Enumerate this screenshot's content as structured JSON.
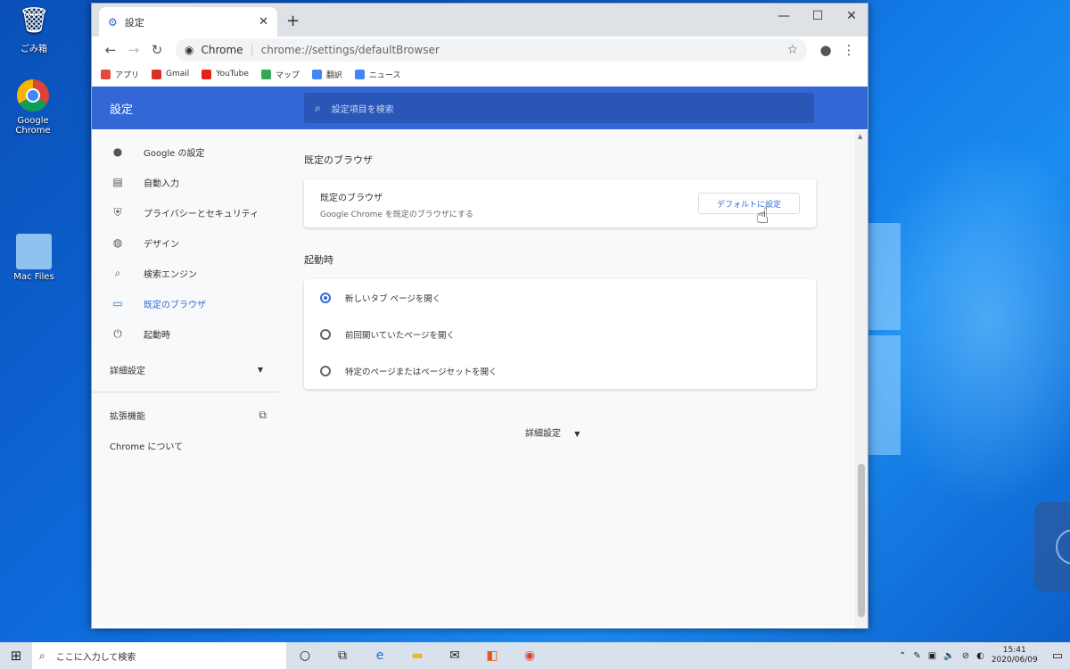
{
  "desktop": {
    "icons": [
      {
        "label": "ごみ箱",
        "glyph": "🗑"
      },
      {
        "label": "Google Chrome",
        "glyph": "◉"
      },
      {
        "label": "Mac Files",
        "glyph": "▇"
      }
    ]
  },
  "browser": {
    "tab_title": "設定",
    "tab_close": "✕",
    "new_tab": "+",
    "window_controls": {
      "minimize": "—",
      "maximize": "☐",
      "close": "✕"
    },
    "omnibox": {
      "site_label": "Chrome",
      "url": "chrome://settings/defaultBrowser"
    },
    "bookmarks": [
      {
        "label": "アプリ",
        "color": "#e24b3b"
      },
      {
        "label": "Gmail",
        "color": "#d93025"
      },
      {
        "label": "YouTube",
        "color": "#e62117"
      },
      {
        "label": "マップ",
        "color": "#34a853"
      },
      {
        "label": "翻訳",
        "color": "#4285f4"
      },
      {
        "label": "ニュース",
        "color": "#4285f4"
      }
    ]
  },
  "settings": {
    "header_title": "設定",
    "search_placeholder": "設定項目を検索",
    "accent": "#3367d6",
    "sidebar": {
      "items": [
        {
          "label": "Google の設定",
          "icon": "person-icon",
          "glyph": "👤"
        },
        {
          "label": "自動入力",
          "icon": "clipboard-icon",
          "glyph": "📋"
        },
        {
          "label": "プライバシーとセキュリティ",
          "icon": "shield-icon",
          "glyph": "⛨"
        },
        {
          "label": "デザイン",
          "icon": "palette-icon",
          "glyph": "🎨"
        },
        {
          "label": "検索エンジン",
          "icon": "search-icon",
          "glyph": "⌕"
        },
        {
          "label": "既定のブラウザ",
          "icon": "browser-window-icon",
          "glyph": "▭"
        },
        {
          "label": "起動時",
          "icon": "power-icon",
          "glyph": "⏻"
        }
      ],
      "advanced_label": "詳細設定",
      "extensions_label": "拡張機能",
      "about_label": "Chrome について"
    },
    "default_browser": {
      "section_title": "既定のブラウザ",
      "card_label": "既定のブラウザ",
      "card_sub": "Google Chrome を既定のブラウザにする",
      "button_label": "デフォルトに設定"
    },
    "startup": {
      "section_title": "起動時",
      "options": [
        {
          "label": "新しいタブ ページを開く",
          "selected": true
        },
        {
          "label": "前回開いていたページを開く",
          "selected": false
        },
        {
          "label": "特定のページまたはページセットを開く",
          "selected": false
        }
      ]
    },
    "advanced_center_label": "詳細設定"
  },
  "taskbar": {
    "search_placeholder": "ここに入力して検索",
    "time": "15:41",
    "date": "2020/06/09"
  }
}
